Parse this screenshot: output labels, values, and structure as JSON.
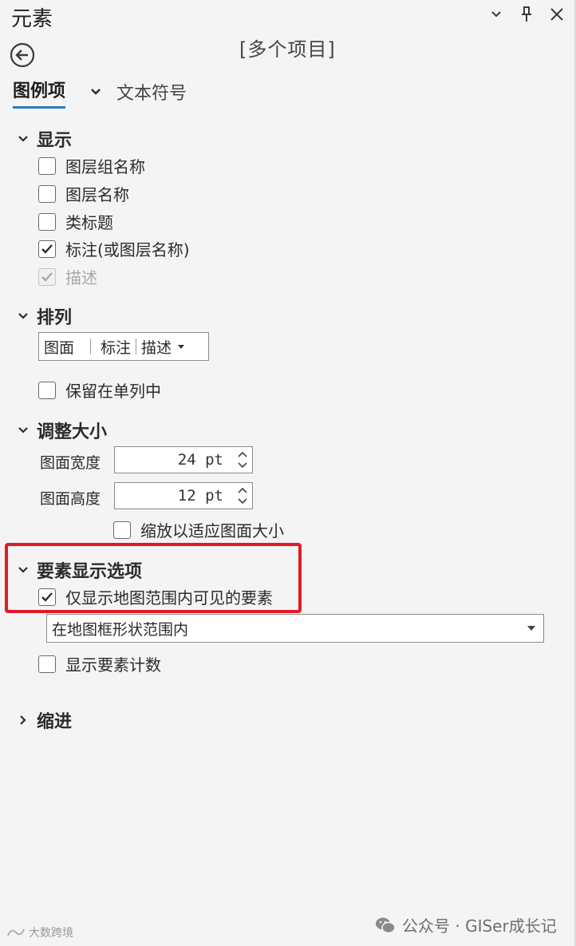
{
  "panel": {
    "title": "元素",
    "items_title": "[多个项目]"
  },
  "tabs": [
    {
      "label": "图例项",
      "active": true
    },
    {
      "label": "文本符号",
      "active": false
    }
  ],
  "sections": {
    "display": {
      "title": "显示",
      "options": [
        {
          "label": "图层组名称",
          "checked": false,
          "enabled": true
        },
        {
          "label": "图层名称",
          "checked": false,
          "enabled": true
        },
        {
          "label": "类标题",
          "checked": false,
          "enabled": true
        },
        {
          "label": "标注(或图层名称)",
          "checked": true,
          "enabled": true
        },
        {
          "label": "描述",
          "checked": true,
          "enabled": false
        }
      ]
    },
    "arrangement": {
      "title": "排列",
      "select_parts": [
        "图面",
        "标注",
        "描述"
      ],
      "keep_single_column": {
        "label": "保留在单列中",
        "checked": false
      }
    },
    "resize": {
      "title": "调整大小",
      "patch_width_label": "图面宽度",
      "patch_width_value": "24 pt",
      "patch_height_label": "图面高度",
      "patch_height_value": "12 pt",
      "scale_to_fit": {
        "label": "缩放以适应图面大小",
        "checked": false
      }
    },
    "feature_display": {
      "title": "要素显示选项",
      "only_visible": {
        "label": "仅显示地图范围内可见的要素",
        "checked": true
      },
      "extent_select": "在地图框形状范围内",
      "show_count": {
        "label": "显示要素计数",
        "checked": false
      }
    },
    "indent": {
      "title": "缩进"
    }
  },
  "watermark": {
    "right": "公众号 · GISer成长记",
    "left": "大数跨境"
  },
  "colors": {
    "accent": "#2a7ab8",
    "highlight": "#e21a26"
  }
}
